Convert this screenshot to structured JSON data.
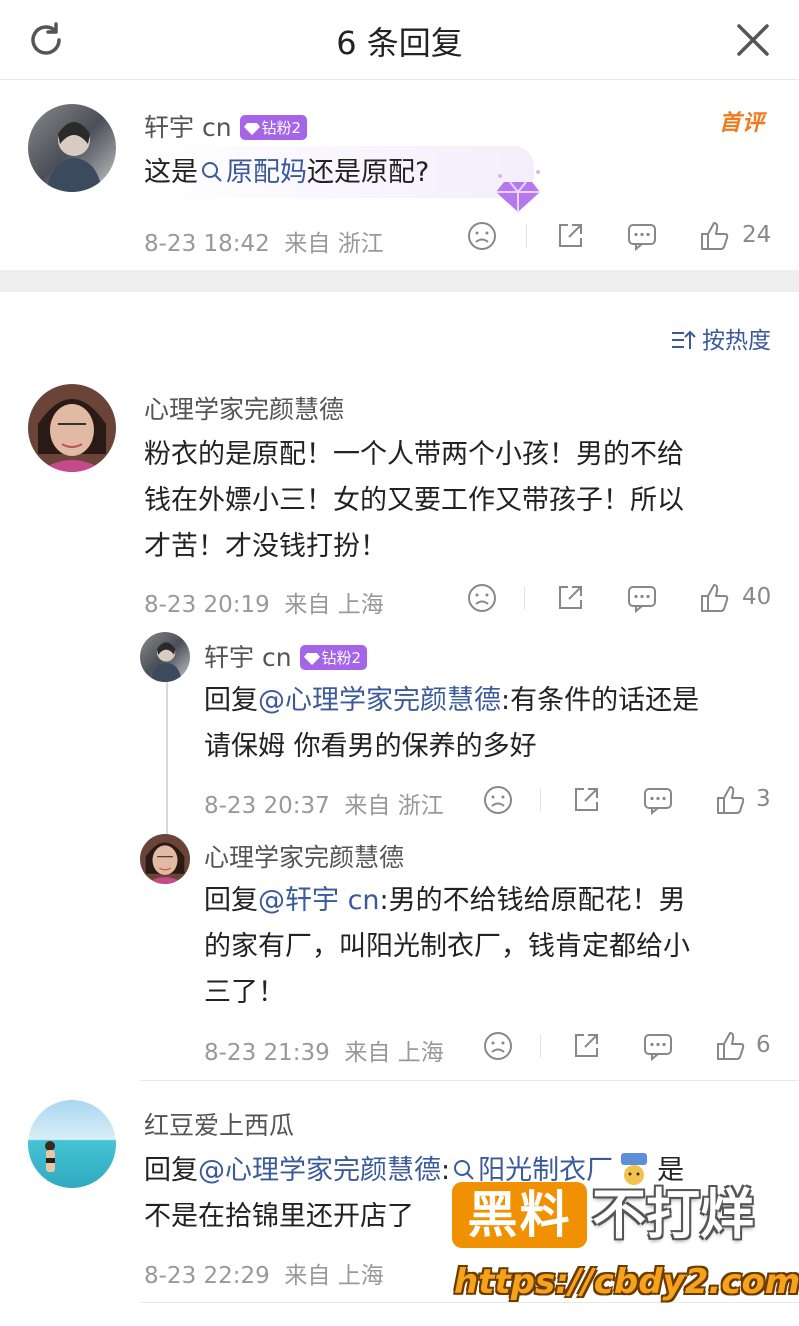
{
  "header": {
    "title": "6 条回复",
    "refresh_icon": "refresh-icon",
    "close_icon": "close-icon"
  },
  "root_comment": {
    "username": "轩宇 cn",
    "badge": "钻粉2",
    "first_comment_tag": "首评",
    "text_before": "这是",
    "link": "原配妈",
    "text_after": "还是原配?",
    "time": "8-23 18:42",
    "location": "来自 浙江",
    "likes": "24"
  },
  "sort": {
    "label": "按热度"
  },
  "comments": [
    {
      "username": "心理学家完颜慧德",
      "lines": [
        "粉衣的是原配！一个人带两个小孩！男的不给",
        "钱在外嫖小三！女的又要工作又带孩子！所以",
        "才苦！才没钱打扮！"
      ],
      "time": "8-23 20:19",
      "location": "来自 上海",
      "likes": "40"
    },
    {
      "username": "轩宇 cn",
      "badge": "钻粉2",
      "reply_prefix": "回复",
      "mention": "@心理学家完颜慧德",
      "line1": ":有条件的话还是",
      "line2": "请保姆 你看男的保养的多好",
      "time": "8-23 20:37",
      "location": "来自 浙江",
      "likes": "3"
    },
    {
      "username": "心理学家完颜慧德",
      "reply_prefix": "回复",
      "mention": "@轩宇 cn",
      "line1": ":男的不给钱给原配花！男",
      "line2": "的家有厂，叫阳光制衣厂，钱肯定都给小",
      "line3": "三了！",
      "time": "8-23 21:39",
      "location": "来自 上海",
      "likes": "6"
    },
    {
      "username": "红豆爱上西瓜",
      "reply_prefix": "回复",
      "mention": "@心理学家完颜慧德",
      "colon": ":",
      "link": "阳光制衣厂",
      "line1_after": "是",
      "line2": "不是在拾锦里还开店了",
      "time": "8-23 22:29",
      "location": "来自 上海"
    }
  ],
  "watermark": {
    "box": "黑料",
    "text": "不打烊",
    "url": "https://cbdy2.com"
  },
  "colors": {
    "link": "#3a5a9b",
    "badge": "#a565e8",
    "first_comment": "#f07a1e",
    "watermark_orange": "#f19000"
  }
}
